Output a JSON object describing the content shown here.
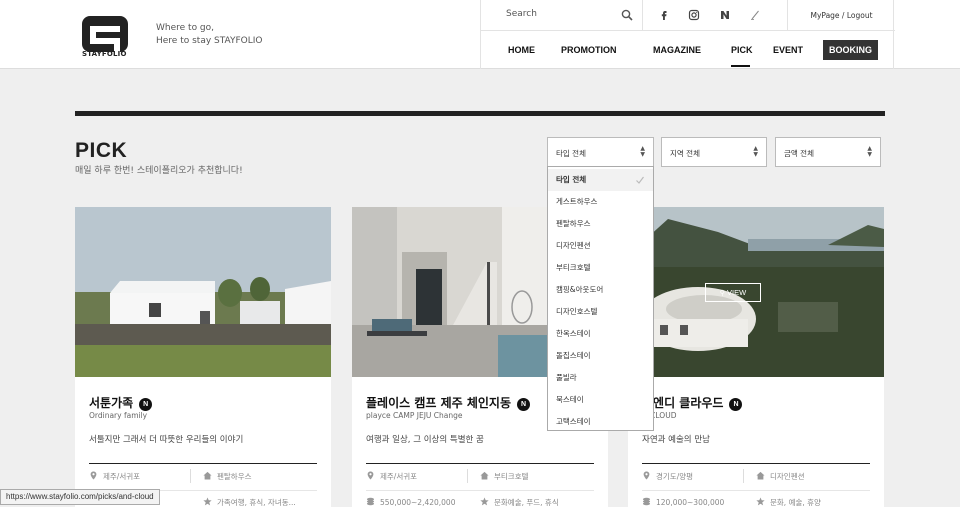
{
  "header": {
    "logo_text": "STAYFOLIO",
    "tagline_1": "Where to go,",
    "tagline_2": "Here to stay STAYFOLIO",
    "search_placeholder": "Search",
    "mypage_logout": "MyPage / Logout",
    "nav": {
      "home": "HOME",
      "promotion": "PROMOTION",
      "magazine": "MAGAZINE",
      "pick": "PICK",
      "event": "EVENT",
      "booking": "BOOKING"
    }
  },
  "page": {
    "title": "PICK",
    "subtitle": "매일 하루 한번! 스테이폴리오가 추천합니다!"
  },
  "filters": {
    "type": "타입 전체",
    "region": "지역 전체",
    "price": "금액 전체"
  },
  "dropdown": {
    "items": [
      "타입 전체",
      "게스트하우스",
      "펜탈하우스",
      "디자인펜션",
      "부티크호텔",
      "캠핑&아웃도어",
      "디자인호스텔",
      "한옥스테이",
      "돌집스테이",
      "풀빌라",
      "북스테이",
      "고택스테이"
    ],
    "selected_index": 0
  },
  "cards": [
    {
      "title": "서툰가족",
      "subtitle_en": "Ordinary family",
      "description": "서툴지만 그래서 더 따뜻한 우리들의 이야기",
      "location": "제주/서귀포",
      "type": "펜탈하우스",
      "price": "",
      "tags": "가족여행, 휴식, 자녀동..."
    },
    {
      "title": "플레이스 캠프 제주 체인지동",
      "subtitle_en": "playce CAMP JEJU Change",
      "description": "여행과 일상, 그 이상의 특별한 꿈",
      "location": "제주/서귀포",
      "type": "부티크호텔",
      "price": "550,000~2,420,000",
      "tags": "문화예술, 푸드, 휴식"
    },
    {
      "title": "이엔디 클라우드",
      "subtitle_en": "D CLOUD",
      "description": "자연과 예술의 만남",
      "location": "경기도/양평",
      "type": "디자인펜션",
      "price": "120,000~300,000",
      "tags": "문화, 예술, 휴양"
    }
  ],
  "view_label": "VIEW",
  "status_url": "https://www.stayfolio.com/picks/and-cloud"
}
